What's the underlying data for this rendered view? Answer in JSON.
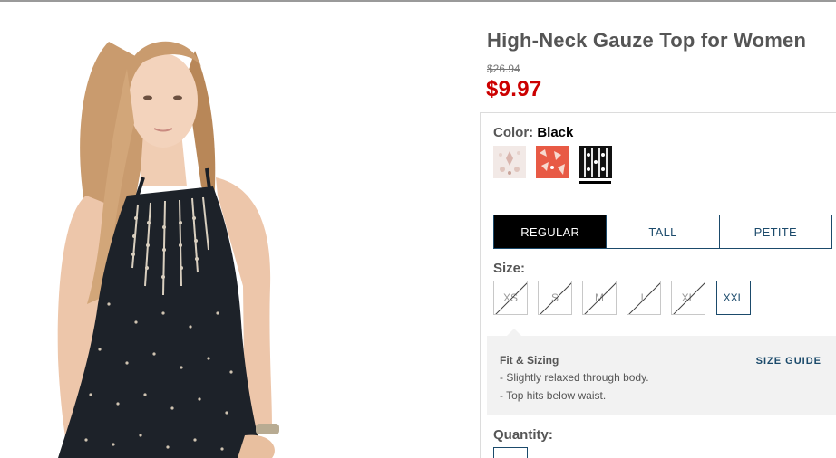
{
  "product": {
    "title": "High-Neck Gauze Top for Women",
    "original_price": "$26.94",
    "sale_price": "$9.97",
    "price_color": "#cc0000",
    "image_icon": "product-photo-model-black-top"
  },
  "color": {
    "label": "Color:",
    "selected": "Black",
    "swatches": [
      {
        "name": "Cream floral",
        "hex": "#efe4e0"
      },
      {
        "name": "Coral print",
        "hex": "#e85a45"
      },
      {
        "name": "Black",
        "hex": "#111111",
        "selected": true
      }
    ]
  },
  "fit_tabs": [
    {
      "label": "REGULAR",
      "active": true
    },
    {
      "label": "TALL",
      "active": false
    },
    {
      "label": "PETITE",
      "active": false
    }
  ],
  "size": {
    "label": "Size:",
    "options": [
      {
        "label": "XS",
        "available": false
      },
      {
        "label": "S",
        "available": false
      },
      {
        "label": "M",
        "available": false
      },
      {
        "label": "L",
        "available": false
      },
      {
        "label": "XL",
        "available": false
      },
      {
        "label": "XXL",
        "available": true
      }
    ]
  },
  "fit_sizing": {
    "title": "Fit & Sizing",
    "lines": [
      "- Slightly relaxed through body.",
      "- Top hits below waist."
    ],
    "guide_link": "SIZE GUIDE"
  },
  "quantity": {
    "label": "Quantity:"
  },
  "colors": {
    "accent": "#1b4a6b",
    "active_tab_bg": "#000000"
  }
}
